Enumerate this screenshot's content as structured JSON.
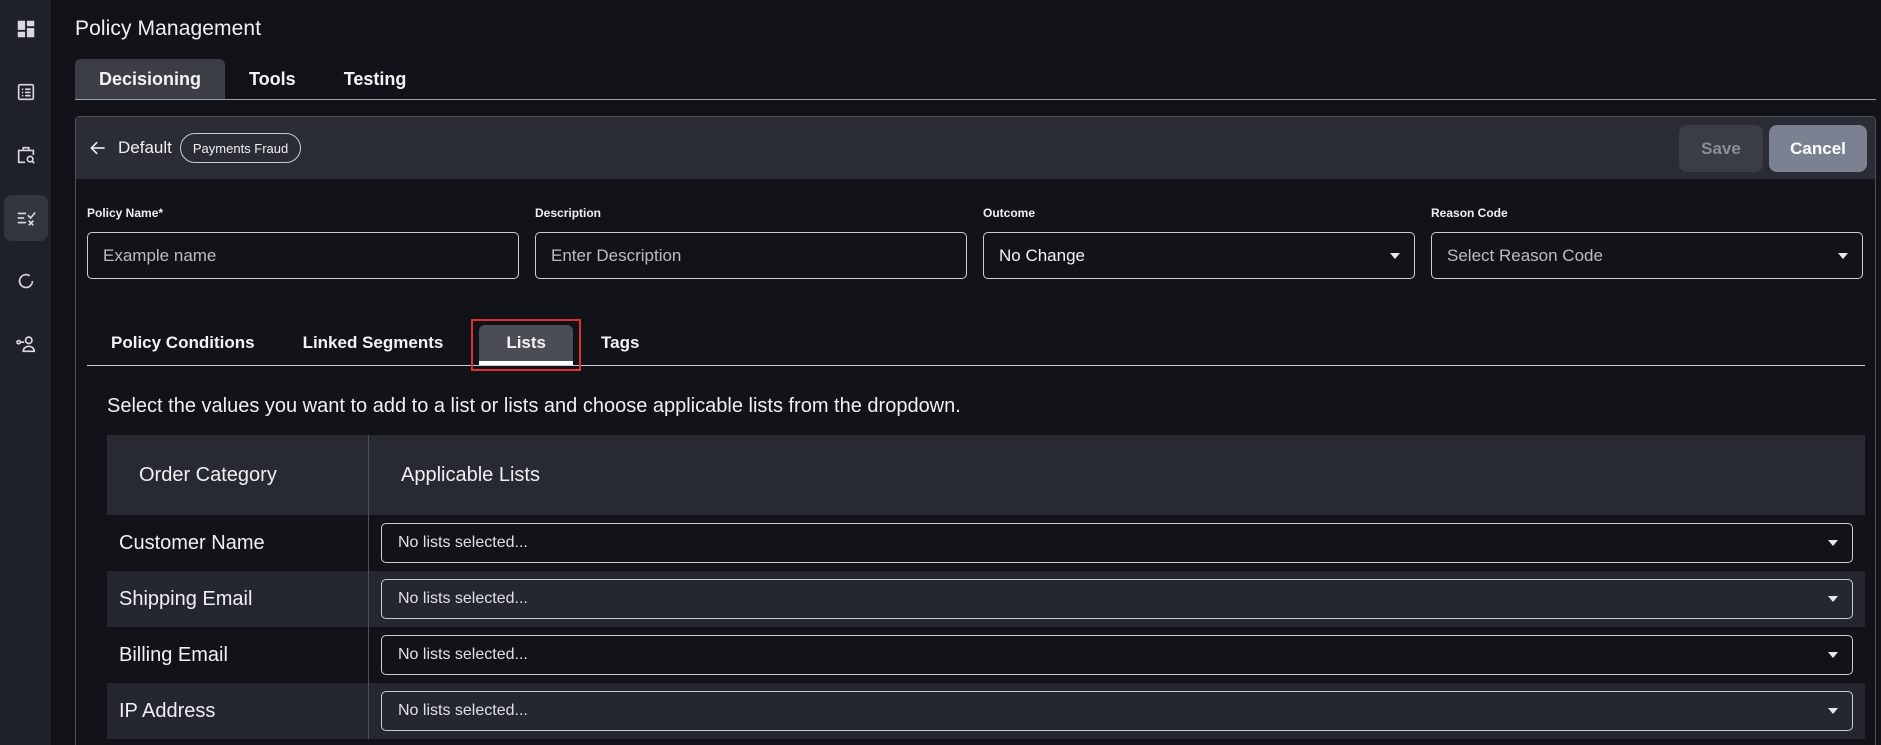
{
  "sidebar": {
    "items": [
      {
        "name": "dashboard-icon"
      },
      {
        "name": "list-icon"
      },
      {
        "name": "case-search-icon"
      },
      {
        "name": "policy-checklist-icon",
        "active": true
      },
      {
        "name": "refresh-cycle-icon"
      },
      {
        "name": "user-connect-icon"
      }
    ]
  },
  "page": {
    "title": "Policy Management"
  },
  "top_tabs": [
    {
      "label": "Decisioning",
      "active": true
    },
    {
      "label": "Tools"
    },
    {
      "label": "Testing"
    }
  ],
  "card": {
    "breadcrumb": "Default",
    "badge": "Payments Fraud",
    "save_label": "Save",
    "cancel_label": "Cancel"
  },
  "form": {
    "policy_name": {
      "label": "Policy Name*",
      "placeholder": "Example name"
    },
    "description": {
      "label": "Description",
      "placeholder": "Enter Description"
    },
    "outcome": {
      "label": "Outcome",
      "value": "No Change"
    },
    "reason_code": {
      "label": "Reason Code",
      "placeholder": "Select Reason Code"
    }
  },
  "inner_tabs": [
    {
      "label": "Policy Conditions"
    },
    {
      "label": "Linked Segments"
    },
    {
      "label": "Lists",
      "active": true
    },
    {
      "label": "Tags"
    }
  ],
  "lists": {
    "helper_text": "Select the values you want to add to a list or lists and choose applicable lists from the dropdown.",
    "columns": [
      "Order Category",
      "Applicable Lists"
    ],
    "rows": [
      {
        "category": "Customer Name",
        "selection": "No lists selected..."
      },
      {
        "category": "Shipping Email",
        "selection": "No lists selected..."
      },
      {
        "category": "Billing Email",
        "selection": "No lists selected..."
      },
      {
        "category": "IP Address",
        "selection": "No lists selected..."
      }
    ]
  },
  "colors": {
    "background": "#121318",
    "rail": "#1f2128",
    "panel_header": "#2a2d35",
    "cancel_button": "#7a8191",
    "highlight_border": "#e03131"
  }
}
